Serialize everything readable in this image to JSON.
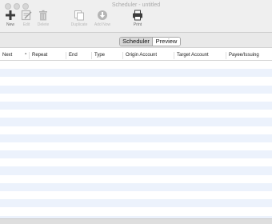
{
  "window": {
    "title": "Scheduler - untitled"
  },
  "toolbar": {
    "new_label": "New",
    "edit_label": "Edit",
    "delete_label": "Delete",
    "duplicate_label": "Duplicate",
    "add_now_label": "Add Now",
    "print_label": "Print"
  },
  "tabs": {
    "scheduler_label": "Scheduler",
    "preview_label": "Preview",
    "selected": "Scheduler"
  },
  "table": {
    "columns": [
      "Next",
      "^",
      "Repeat",
      "End",
      "Type",
      "Origin Account",
      "Target Account",
      "Payee/Issuing"
    ],
    "rows": []
  },
  "colors": {
    "row_alt": "#ecf2fc",
    "toolbar_bg": "#efefef"
  }
}
